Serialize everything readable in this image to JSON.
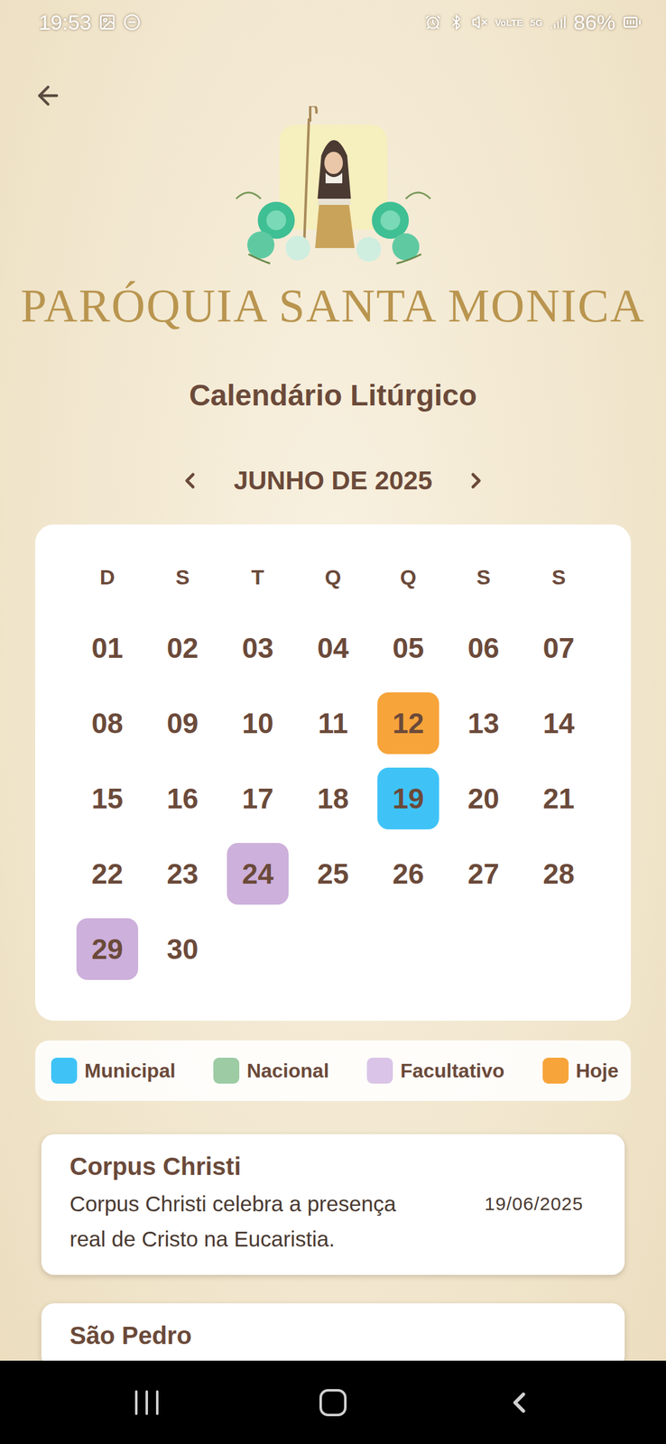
{
  "status_bar": {
    "time": "19:53",
    "volte": "VoLTE",
    "network": "5G",
    "battery": "86%"
  },
  "header": {
    "title": "PARÓQUIA SANTA MONICA",
    "subtitle": "Calendário Litúrgico"
  },
  "calendar": {
    "month": "JUNHO DE 2025",
    "weekdays": [
      "D",
      "S",
      "T",
      "Q",
      "Q",
      "S",
      "S"
    ],
    "days": [
      {
        "label": "01"
      },
      {
        "label": "02"
      },
      {
        "label": "03"
      },
      {
        "label": "04"
      },
      {
        "label": "05"
      },
      {
        "label": "06"
      },
      {
        "label": "07"
      },
      {
        "label": "08"
      },
      {
        "label": "09"
      },
      {
        "label": "10"
      },
      {
        "label": "11"
      },
      {
        "label": "12",
        "color": "#f7a43a"
      },
      {
        "label": "13"
      },
      {
        "label": "14"
      },
      {
        "label": "15"
      },
      {
        "label": "16"
      },
      {
        "label": "17"
      },
      {
        "label": "18"
      },
      {
        "label": "19",
        "color": "#3fc3f7"
      },
      {
        "label": "20"
      },
      {
        "label": "21"
      },
      {
        "label": "22"
      },
      {
        "label": "23"
      },
      {
        "label": "24",
        "color": "#cdb0db"
      },
      {
        "label": "25"
      },
      {
        "label": "26"
      },
      {
        "label": "27"
      },
      {
        "label": "28"
      },
      {
        "label": "29",
        "color": "#cdb0db"
      },
      {
        "label": "30"
      }
    ]
  },
  "legend": [
    {
      "label": "Municipal",
      "color": "#3fc3f7"
    },
    {
      "label": "Nacional",
      "color": "#9ccba4"
    },
    {
      "label": "Facultativo",
      "color": "#dac4e7"
    },
    {
      "label": "Hoje",
      "color": "#f7a43a"
    }
  ],
  "events": [
    {
      "title": "Corpus Christi",
      "description": "Corpus Christi celebra a presença real de Cristo na Eucaristia.",
      "date": "19/06/2025"
    },
    {
      "title": "São Pedro"
    }
  ]
}
